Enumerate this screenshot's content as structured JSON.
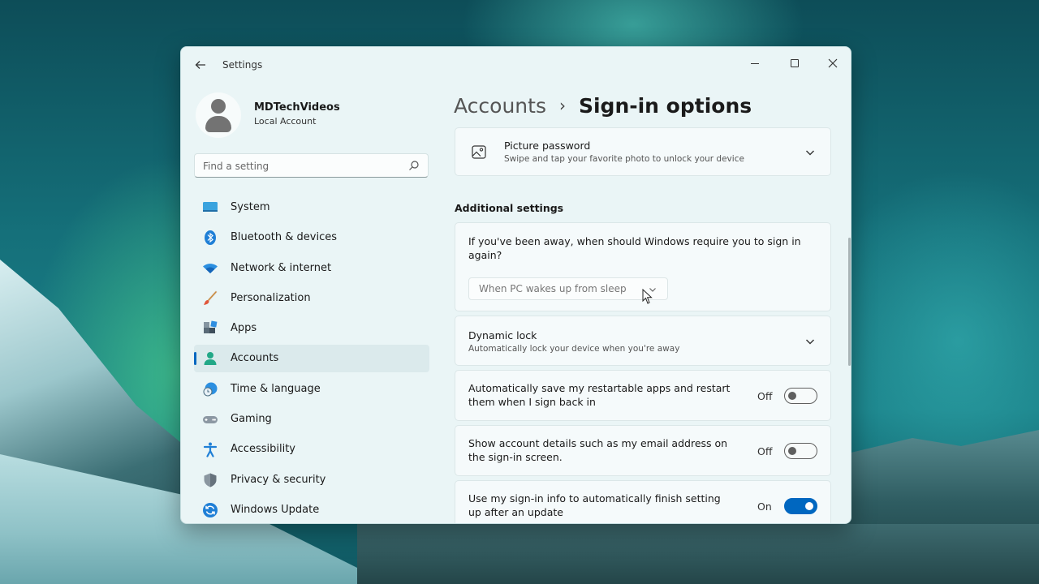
{
  "window": {
    "title": "Settings"
  },
  "profile": {
    "name": "MDTechVideos",
    "account_type": "Local Account"
  },
  "search": {
    "placeholder": "Find a setting"
  },
  "nav": {
    "items": [
      {
        "label": "System",
        "icon": "system-icon"
      },
      {
        "label": "Bluetooth & devices",
        "icon": "bluetooth-icon"
      },
      {
        "label": "Network & internet",
        "icon": "wifi-icon"
      },
      {
        "label": "Personalization",
        "icon": "brush-icon"
      },
      {
        "label": "Apps",
        "icon": "apps-icon"
      },
      {
        "label": "Accounts",
        "icon": "account-icon",
        "active": true
      },
      {
        "label": "Time & language",
        "icon": "clock-globe-icon"
      },
      {
        "label": "Gaming",
        "icon": "controller-icon"
      },
      {
        "label": "Accessibility",
        "icon": "accessibility-icon"
      },
      {
        "label": "Privacy & security",
        "icon": "shield-icon"
      },
      {
        "label": "Windows Update",
        "icon": "update-icon"
      }
    ]
  },
  "breadcrumb": {
    "parent": "Accounts",
    "separator": "›",
    "current": "Sign-in options"
  },
  "picture_password": {
    "title": "Picture password",
    "subtitle": "Swipe and tap your favorite photo to unlock your device"
  },
  "additional": {
    "heading": "Additional settings",
    "require_signin": {
      "question": "If you've been away, when should Windows require you to sign in again?",
      "selected": "When PC wakes up from sleep"
    },
    "dynamic_lock": {
      "title": "Dynamic lock",
      "subtitle": "Automatically lock your device when you're away"
    },
    "restart_apps": {
      "title": "Automatically save my restartable apps and restart them when I sign back in",
      "state": "Off"
    },
    "account_details": {
      "title": "Show account details such as my email address on the sign-in screen.",
      "state": "Off"
    },
    "signin_info": {
      "title": "Use my sign-in info to automatically finish setting up after an update",
      "state": "On"
    }
  },
  "colors": {
    "accent": "#0067c0"
  }
}
